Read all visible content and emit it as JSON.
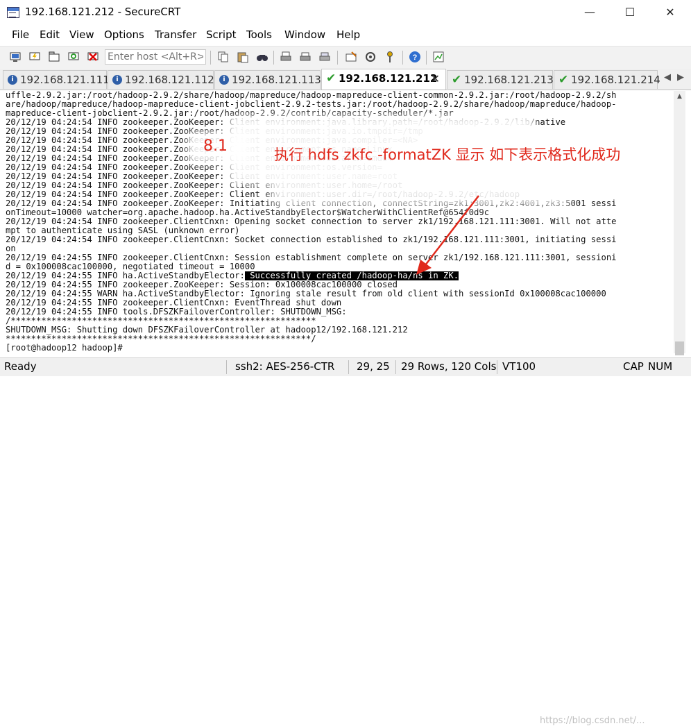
{
  "window": {
    "title": "192.168.121.212 - SecureCRT",
    "minimize_glyph": "—",
    "maximize_glyph": "☐",
    "close_glyph": "✕"
  },
  "menu": [
    "File",
    "Edit",
    "View",
    "Options",
    "Transfer",
    "Script",
    "Tools",
    "Window",
    "Help"
  ],
  "toolbar": {
    "host_placeholder": "Enter host <Alt+R>",
    "icons_left": [
      "connect-icon",
      "quick-connect-icon",
      "connect-tab-icon",
      "reconnect-icon",
      "disconnect-icon"
    ],
    "icons_right": [
      "copy-icon",
      "paste-icon",
      "find-icon",
      "print-icon",
      "print-setup-icon",
      "print-selection-icon",
      "session-options-icon",
      "global-options-icon",
      "keymap-icon",
      "help-icon",
      "script-icon"
    ]
  },
  "tabs": [
    {
      "label": "192.168.121.111",
      "status": "info",
      "active": false
    },
    {
      "label": "192.168.121.112",
      "status": "info",
      "active": false
    },
    {
      "label": "192.168.121.113",
      "status": "info",
      "active": false
    },
    {
      "label": "192.168.121.212",
      "status": "connected",
      "active": true
    },
    {
      "label": "192.168.121.213",
      "status": "connected",
      "active": false
    },
    {
      "label": "192.168.121.214",
      "status": "connected",
      "active": false
    }
  ],
  "tab_close_glyph": "✕",
  "terminal": {
    "lines": [
      "uffle-2.9.2.jar:/root/hadoop-2.9.2/share/hadoop/mapreduce/hadoop-mapreduce-client-common-2.9.2.jar:/root/hadoop-2.9.2/sh",
      "are/hadoop/mapreduce/hadoop-mapreduce-client-jobclient-2.9.2-tests.jar:/root/hadoop-2.9.2/share/hadoop/mapreduce/hadoop-",
      "mapreduce-client-jobclient-2.9.2.jar:/root/hadoop-2.9.2/contrib/capacity-scheduler/*.jar",
      "20/12/19 04:24:54 INFO zookeeper.ZooKeeper: Client environment:java.library.path=/root/hadoop-2.9.2/lib/native",
      "20/12/19 04:24:54 INFO zookeeper.ZooKeeper: Client environment:java.io.tmpdir=/tmp",
      "20/12/19 04:24:54 INFO zookeeper.ZooKeeper: Client environment:java.compiler=<NA>",
      "20/12/19 04:24:54 INFO zookeeper.ZooKeeper: Client environment:os.name=Linux",
      "20/12/19 04:24:54 INFO zookeeper.ZooKeeper: Client environment:os.arch=amd64",
      "20/12/19 04:24:54 INFO zookeeper.ZooKeeper: Client environment:os.version=",
      "20/12/19 04:24:54 INFO zookeeper.ZooKeeper: Client environment:user.name=root",
      "20/12/19 04:24:54 INFO zookeeper.ZooKeeper: Client environment:user.home=/root",
      "20/12/19 04:24:54 INFO zookeeper.ZooKeeper: Client environment:user.dir=/root/hadoop-2.9.2/etc/hadoop",
      "20/12/19 04:24:54 INFO zookeeper.ZooKeeper: Initiating client connection, connectString=zk1:3001,zk2:4001,zk3:5001 sessi",
      "onTimeout=10000 watcher=org.apache.hadoop.ha.ActiveStandbyElector$WatcherWithClientRef@654f0d9c",
      "20/12/19 04:24:54 INFO zookeeper.ClientCnxn: Opening socket connection to server zk1/192.168.121.111:3001. Will not atte",
      "mpt to authenticate using SASL (unknown error)",
      "20/12/19 04:24:54 INFO zookeeper.ClientCnxn: Socket connection established to zk1/192.168.121.111:3001, initiating sessi",
      "on",
      "20/12/19 04:24:55 INFO zookeeper.ClientCnxn: Session establishment complete on server zk1/192.168.121.111:3001, sessioni",
      "d = 0x100008cac100000, negotiated timeout = 10000",
      "",
      "20/12/19 04:24:55 INFO zookeeper.ZooKeeper: Session: 0x100008cac100000 closed",
      "20/12/19 04:24:55 WARN ha.ActiveStandbyElector: Ignoring stale result from old client with sessionId 0x100008cac100000",
      "20/12/19 04:24:55 INFO zookeeper.ClientCnxn: EventThread shut down",
      "20/12/19 04:24:55 INFO tools.DFSZKFailoverController: SHUTDOWN_MSG:",
      "/************************************************************",
      "SHUTDOWN_MSG: Shutting down DFSZKFailoverController at hadoop12/192.168.121.212",
      "************************************************************/",
      "[root@hadoop12 hadoop]# "
    ],
    "success_prefix": "20/12/19 04:24:55 INFO ha.ActiveStandbyElector:",
    "success_highlight": " Successfully created /hadoop-ha/ns in ZK."
  },
  "annotation": {
    "step": "8.1",
    "text": "执行 hdfs zkfc -formatZK  显示 如下表示格式化成功",
    "color": "#e0281b"
  },
  "status": {
    "ready": "Ready",
    "cipher": "ssh2: AES-256-CTR",
    "cursor": "29,  25",
    "size": "29 Rows, 120 Cols",
    "emulation": "VT100",
    "cap": "CAP",
    "num": "NUM"
  },
  "watermark": "https://blog.csdn.net/..."
}
